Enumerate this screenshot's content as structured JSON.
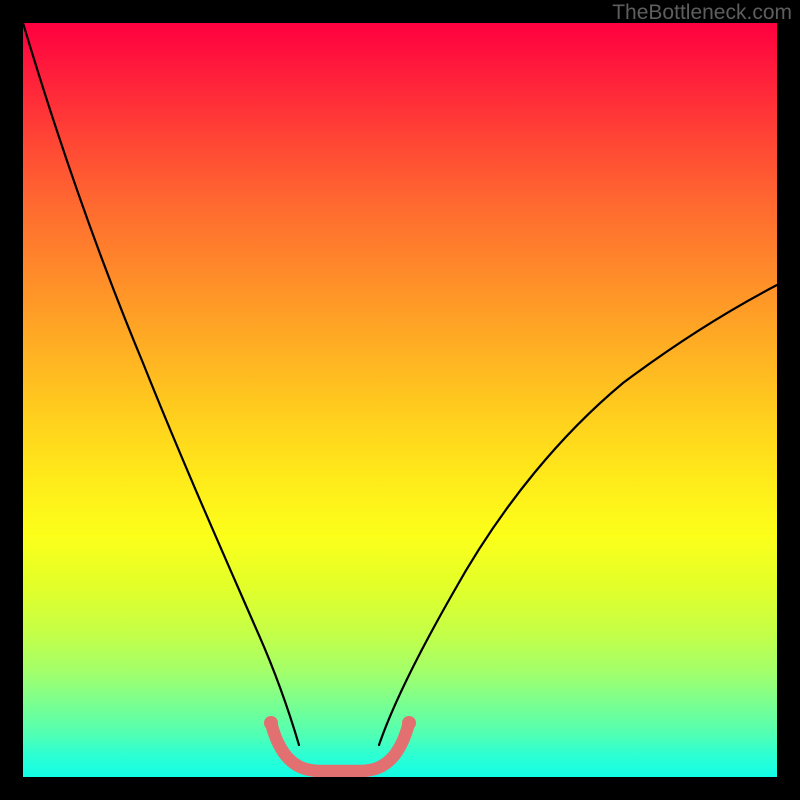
{
  "watermark": "TheBottleneck.com",
  "chart_data": {
    "type": "line",
    "title": "",
    "xlabel": "",
    "ylabel": "",
    "xlim": [
      0,
      100
    ],
    "ylim": [
      0,
      100
    ],
    "background_gradient": {
      "top": "#ff0040",
      "mid": "#ffe91a",
      "bottom": "#12fce6"
    },
    "series": [
      {
        "name": "left-curve",
        "stroke": "#000000",
        "x": [
          0,
          4,
          8,
          12,
          16,
          20,
          24,
          28,
          31,
          33,
          34.5
        ],
        "y": [
          100,
          87,
          73,
          58,
          44,
          31,
          20,
          11,
          4.5,
          1.5,
          0.5
        ]
      },
      {
        "name": "right-curve",
        "stroke": "#000000",
        "x": [
          45,
          48,
          52,
          58,
          64,
          70,
          76,
          82,
          88,
          94,
          100
        ],
        "y": [
          0.5,
          1.5,
          5,
          12,
          20,
          28,
          35,
          42,
          48,
          53,
          58
        ]
      },
      {
        "name": "valley-highlight",
        "stroke": "#e06d6d",
        "width_fraction": 0.016,
        "x": [
          30.5,
          32,
          34,
          36,
          38,
          40,
          42,
          44,
          45.5,
          47
        ],
        "y": [
          4.2,
          2.2,
          0.9,
          0.6,
          0.6,
          0.6,
          0.6,
          0.9,
          2.0,
          3.8
        ]
      }
    ],
    "valley_minimum_x": 39,
    "notes": "V-shaped bottleneck curve on rainbow gradient; rounded pink segment marks the optimal (bottleneck-free) region at the valley floor."
  }
}
